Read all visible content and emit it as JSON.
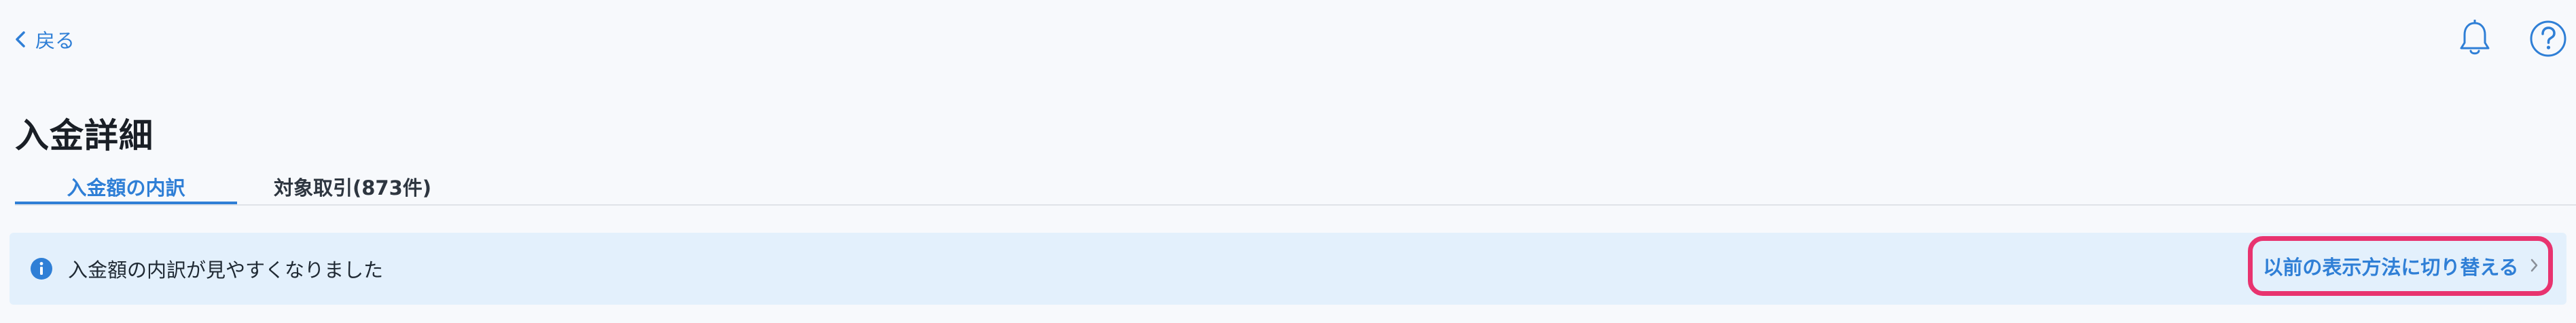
{
  "header": {
    "back_label": "戻る",
    "icons": [
      "chevron-left-icon",
      "bell-icon",
      "help-icon"
    ]
  },
  "page": {
    "title": "入金詳細"
  },
  "tabs": [
    {
      "label": "入金額の内訳",
      "active": true
    },
    {
      "label": "対象取引(873件)",
      "active": false
    }
  ],
  "banner": {
    "icon": "info-icon",
    "message": "入金額の内訳が見やすくなりました",
    "action_label": "以前の表示方法に切り替える"
  },
  "colors": {
    "accent": "#2f7fd6",
    "highlight": "#e8336f",
    "banner_bg": "#e3f0fc",
    "page_bg": "#f7f9fc"
  }
}
